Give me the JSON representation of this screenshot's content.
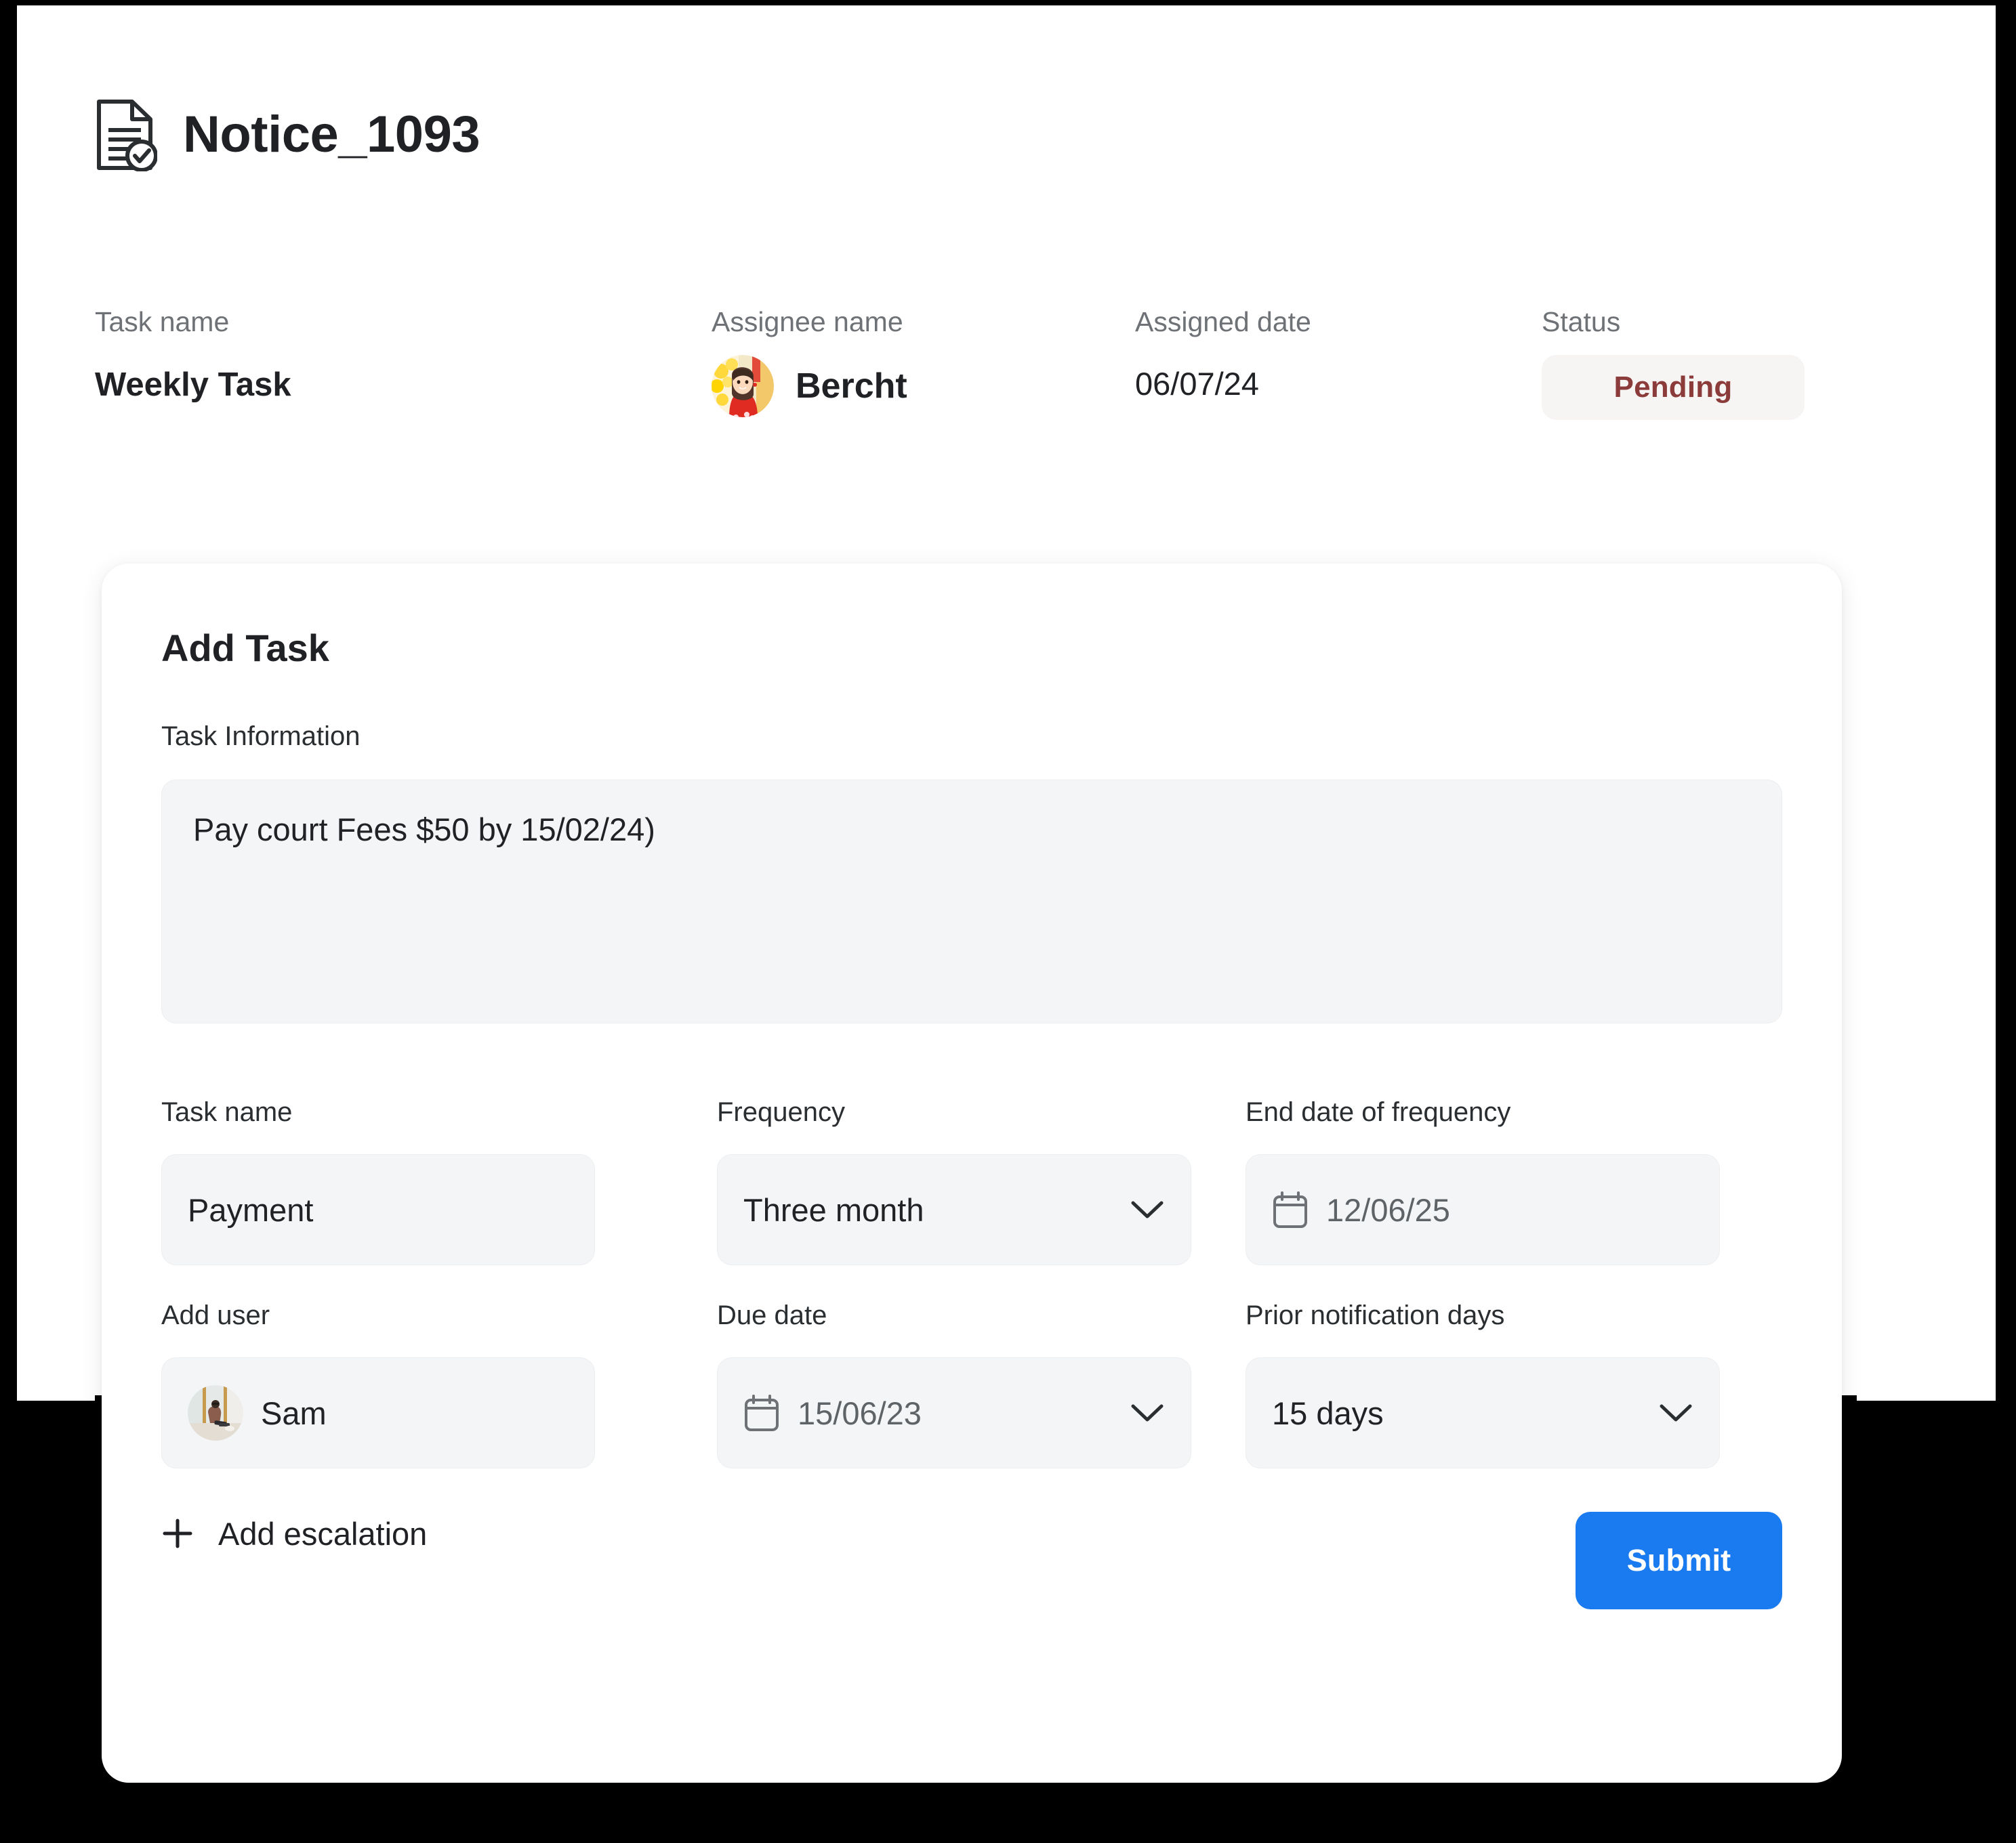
{
  "header": {
    "icon": "document-check-icon",
    "title": "Notice_1093"
  },
  "meta": {
    "task_name_label": "Task name",
    "task_name_value": "Weekly Task",
    "assignee_label": "Assignee name",
    "assignee_name": "Bercht",
    "assignee_avatar": "assignee-avatar",
    "assigned_date_label": "Assigned date",
    "assigned_date_value": "06/07/24",
    "status_label": "Status",
    "status_value": "Pending",
    "status_color": "#8c3b3b",
    "status_bg": "#f7f4f4"
  },
  "card": {
    "title": "Add Task",
    "task_information": {
      "label": "Task Information",
      "value": "Pay court Fees $50 by 15/02/24)",
      "placeholder": "Task Information"
    },
    "fields": {
      "task_name": {
        "label": "Task name",
        "value": "Payment",
        "placeholder": "Task name"
      },
      "frequency": {
        "label": "Frequency",
        "value": "Three month",
        "icon": "chevron-down-icon"
      },
      "end_date_of_frequency": {
        "label": "End date of frequency",
        "value": "12/06/25",
        "icon": "calendar-icon"
      },
      "add_user": {
        "label": "Add user",
        "value": "Sam",
        "avatar": "user-avatar"
      },
      "due_date": {
        "label": "Due date",
        "value": "15/06/23",
        "icon": "calendar-icon",
        "chevron": "chevron-down-icon"
      },
      "prior_notification_days": {
        "label": "Prior notification days",
        "value": "15 days",
        "icon": "chevron-down-icon"
      }
    },
    "footer": {
      "add_escalation_label": "Add escalation",
      "add_escalation_icon": "plus-icon",
      "submit_label": "Submit",
      "submit_color": "#1a7af0"
    }
  }
}
